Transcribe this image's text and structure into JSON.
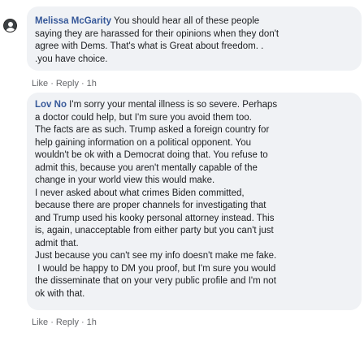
{
  "comments": [
    {
      "author": "Melissa McGarity",
      "lines": [
        " You should hear all of these people",
        "saying they are harassed for their opinions when they don't",
        "agree with Dems. That's what is Great about freedom. .",
        ".you have choice."
      ],
      "actions": {
        "like": "Like",
        "reply": "Reply",
        "time": "1h"
      }
    },
    {
      "author": "Lov No",
      "lines": [
        " I'm sorry your mental illness is so severe. Perhaps",
        "a doctor could help, but I'm sure you avoid them too.",
        "The facts are as such. Trump asked a foreign country for",
        "help gaining information on a political opponent. You",
        "wouldn't be ok with a Democrat doing that. You refuse to",
        "admit this, because you aren't mentally capable of the",
        "change in your world view this would make.",
        "I never asked about what crimes Biden committed,",
        "because there are proper channels for investigating that",
        "and Trump used his kooky personal attorney instead. This",
        "is, again, unacceptable from either party but you can't just",
        "admit that.",
        "Just because you can't see my info doesn't make me fake.",
        " I would be happy to DM you proof, but I'm sure you would",
        "the disseminate that on your very public profile and I'm not",
        "ok with that."
      ],
      "actions": {
        "like": "Like",
        "reply": "Reply",
        "time": "1h"
      }
    }
  ]
}
